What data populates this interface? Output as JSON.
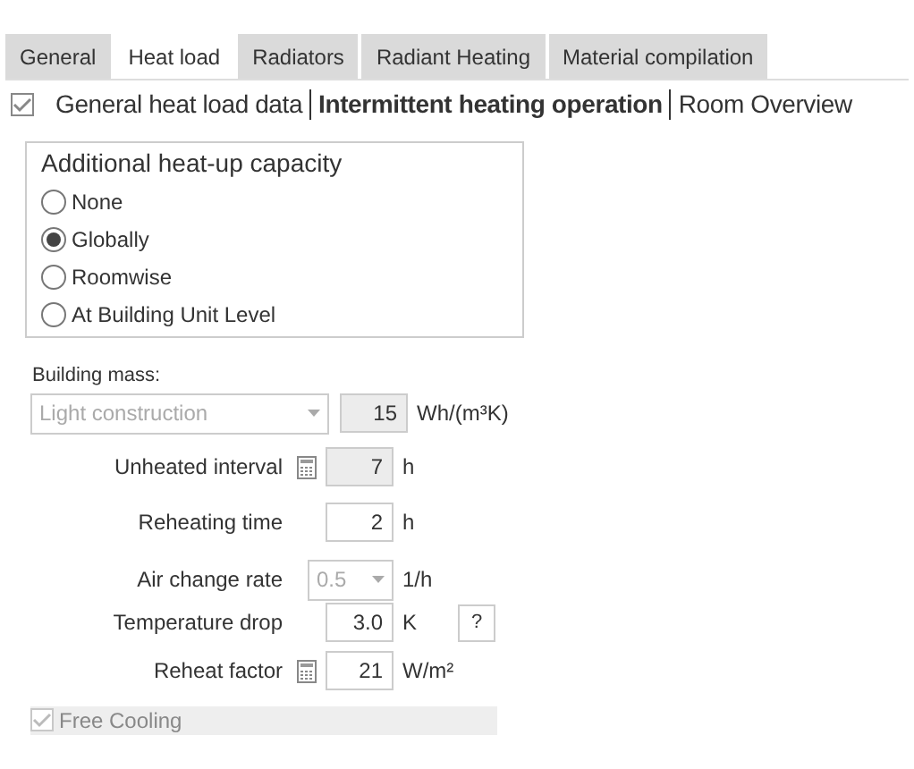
{
  "tabs": [
    {
      "label": "General",
      "selected": false
    },
    {
      "label": "Heat load",
      "selected": true
    },
    {
      "label": "Radiators",
      "selected": false
    },
    {
      "label": "Radiant Heating",
      "selected": false
    },
    {
      "label": "Material compilation",
      "selected": false
    }
  ],
  "subnav": {
    "checked": true,
    "items": [
      {
        "label": "General heat load data",
        "selected": false
      },
      {
        "label": "Intermittent heating operation",
        "selected": true
      },
      {
        "label": "Room Overview",
        "selected": false
      }
    ]
  },
  "heatup_capacity": {
    "title": "Additional heat-up capacity",
    "options": [
      {
        "label": "None",
        "selected": false
      },
      {
        "label": "Globally",
        "selected": true
      },
      {
        "label": "Roomwise",
        "selected": false
      },
      {
        "label": "At Building Unit Level",
        "selected": false
      }
    ]
  },
  "building_mass": {
    "label": "Building mass:",
    "combo": {
      "value": "Light construction",
      "disabled": true
    },
    "value": "15",
    "disabled": true,
    "unit": "Wh/(m³K)"
  },
  "rows": [
    {
      "kind": "number",
      "label": "Unheated interval",
      "calculator": true,
      "value": "7",
      "disabled": true,
      "unit": "h"
    },
    {
      "kind": "number",
      "label": "Reheating time",
      "calculator": false,
      "value": "2",
      "disabled": false,
      "unit": "h"
    },
    {
      "kind": "combo",
      "label": "Air change rate",
      "value": "0.5",
      "disabled": true,
      "unit": "1/h"
    },
    {
      "kind": "number",
      "label": "Temperature drop",
      "calculator": false,
      "value": "3.0",
      "disabled": false,
      "unit": "K",
      "help": "?"
    },
    {
      "kind": "number",
      "label": "Reheat factor",
      "calculator": true,
      "value": "21",
      "disabled": false,
      "unit": "W/m²"
    }
  ],
  "free_cooling": {
    "label": "Free Cooling",
    "checked": true,
    "disabled": true
  }
}
